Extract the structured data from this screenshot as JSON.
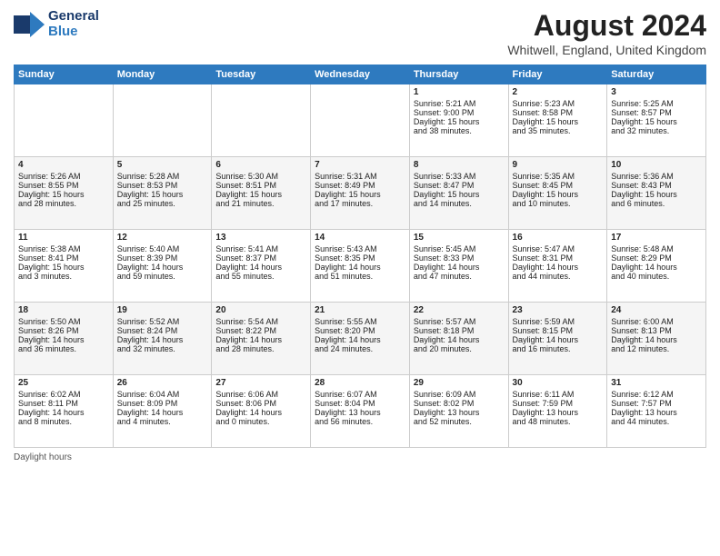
{
  "header": {
    "logo": {
      "line1": "General",
      "line2": "Blue"
    },
    "title": "August 2024",
    "subtitle": "Whitwell, England, United Kingdom"
  },
  "weekdays": [
    "Sunday",
    "Monday",
    "Tuesday",
    "Wednesday",
    "Thursday",
    "Friday",
    "Saturday"
  ],
  "weeks": [
    [
      {
        "day": "",
        "content": ""
      },
      {
        "day": "",
        "content": ""
      },
      {
        "day": "",
        "content": ""
      },
      {
        "day": "",
        "content": ""
      },
      {
        "day": "1",
        "content": "Sunrise: 5:21 AM\nSunset: 9:00 PM\nDaylight: 15 hours\nand 38 minutes."
      },
      {
        "day": "2",
        "content": "Sunrise: 5:23 AM\nSunset: 8:58 PM\nDaylight: 15 hours\nand 35 minutes."
      },
      {
        "day": "3",
        "content": "Sunrise: 5:25 AM\nSunset: 8:57 PM\nDaylight: 15 hours\nand 32 minutes."
      }
    ],
    [
      {
        "day": "4",
        "content": "Sunrise: 5:26 AM\nSunset: 8:55 PM\nDaylight: 15 hours\nand 28 minutes."
      },
      {
        "day": "5",
        "content": "Sunrise: 5:28 AM\nSunset: 8:53 PM\nDaylight: 15 hours\nand 25 minutes."
      },
      {
        "day": "6",
        "content": "Sunrise: 5:30 AM\nSunset: 8:51 PM\nDaylight: 15 hours\nand 21 minutes."
      },
      {
        "day": "7",
        "content": "Sunrise: 5:31 AM\nSunset: 8:49 PM\nDaylight: 15 hours\nand 17 minutes."
      },
      {
        "day": "8",
        "content": "Sunrise: 5:33 AM\nSunset: 8:47 PM\nDaylight: 15 hours\nand 14 minutes."
      },
      {
        "day": "9",
        "content": "Sunrise: 5:35 AM\nSunset: 8:45 PM\nDaylight: 15 hours\nand 10 minutes."
      },
      {
        "day": "10",
        "content": "Sunrise: 5:36 AM\nSunset: 8:43 PM\nDaylight: 15 hours\nand 6 minutes."
      }
    ],
    [
      {
        "day": "11",
        "content": "Sunrise: 5:38 AM\nSunset: 8:41 PM\nDaylight: 15 hours\nand 3 minutes."
      },
      {
        "day": "12",
        "content": "Sunrise: 5:40 AM\nSunset: 8:39 PM\nDaylight: 14 hours\nand 59 minutes."
      },
      {
        "day": "13",
        "content": "Sunrise: 5:41 AM\nSunset: 8:37 PM\nDaylight: 14 hours\nand 55 minutes."
      },
      {
        "day": "14",
        "content": "Sunrise: 5:43 AM\nSunset: 8:35 PM\nDaylight: 14 hours\nand 51 minutes."
      },
      {
        "day": "15",
        "content": "Sunrise: 5:45 AM\nSunset: 8:33 PM\nDaylight: 14 hours\nand 47 minutes."
      },
      {
        "day": "16",
        "content": "Sunrise: 5:47 AM\nSunset: 8:31 PM\nDaylight: 14 hours\nand 44 minutes."
      },
      {
        "day": "17",
        "content": "Sunrise: 5:48 AM\nSunset: 8:29 PM\nDaylight: 14 hours\nand 40 minutes."
      }
    ],
    [
      {
        "day": "18",
        "content": "Sunrise: 5:50 AM\nSunset: 8:26 PM\nDaylight: 14 hours\nand 36 minutes."
      },
      {
        "day": "19",
        "content": "Sunrise: 5:52 AM\nSunset: 8:24 PM\nDaylight: 14 hours\nand 32 minutes."
      },
      {
        "day": "20",
        "content": "Sunrise: 5:54 AM\nSunset: 8:22 PM\nDaylight: 14 hours\nand 28 minutes."
      },
      {
        "day": "21",
        "content": "Sunrise: 5:55 AM\nSunset: 8:20 PM\nDaylight: 14 hours\nand 24 minutes."
      },
      {
        "day": "22",
        "content": "Sunrise: 5:57 AM\nSunset: 8:18 PM\nDaylight: 14 hours\nand 20 minutes."
      },
      {
        "day": "23",
        "content": "Sunrise: 5:59 AM\nSunset: 8:15 PM\nDaylight: 14 hours\nand 16 minutes."
      },
      {
        "day": "24",
        "content": "Sunrise: 6:00 AM\nSunset: 8:13 PM\nDaylight: 14 hours\nand 12 minutes."
      }
    ],
    [
      {
        "day": "25",
        "content": "Sunrise: 6:02 AM\nSunset: 8:11 PM\nDaylight: 14 hours\nand 8 minutes."
      },
      {
        "day": "26",
        "content": "Sunrise: 6:04 AM\nSunset: 8:09 PM\nDaylight: 14 hours\nand 4 minutes."
      },
      {
        "day": "27",
        "content": "Sunrise: 6:06 AM\nSunset: 8:06 PM\nDaylight: 14 hours\nand 0 minutes."
      },
      {
        "day": "28",
        "content": "Sunrise: 6:07 AM\nSunset: 8:04 PM\nDaylight: 13 hours\nand 56 minutes."
      },
      {
        "day": "29",
        "content": "Sunrise: 6:09 AM\nSunset: 8:02 PM\nDaylight: 13 hours\nand 52 minutes."
      },
      {
        "day": "30",
        "content": "Sunrise: 6:11 AM\nSunset: 7:59 PM\nDaylight: 13 hours\nand 48 minutes."
      },
      {
        "day": "31",
        "content": "Sunrise: 6:12 AM\nSunset: 7:57 PM\nDaylight: 13 hours\nand 44 minutes."
      }
    ]
  ],
  "footer": {
    "label": "Daylight hours"
  }
}
